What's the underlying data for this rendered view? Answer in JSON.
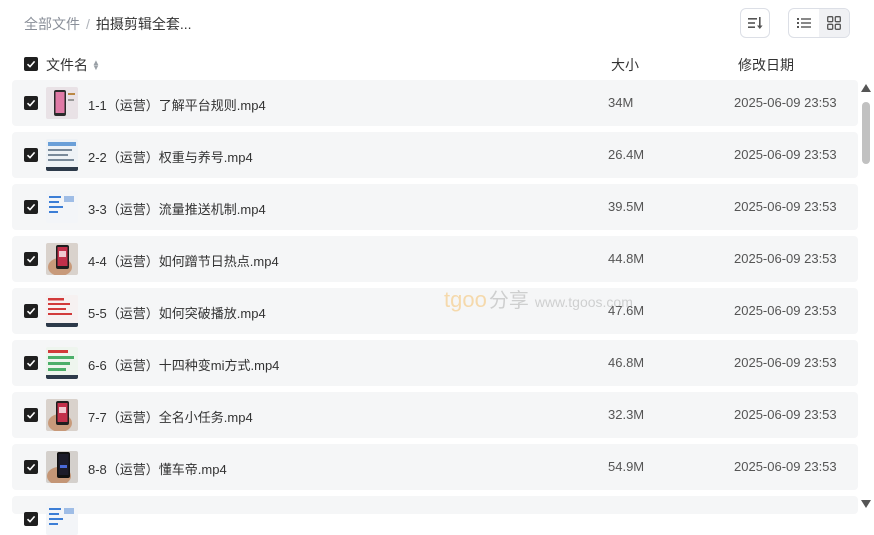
{
  "breadcrumb": {
    "root": "全部文件",
    "separator": "/",
    "current": "拍摄剪辑全套..."
  },
  "toolbar": {
    "sort_icon": "sort-descending-icon",
    "list_view_icon": "list-view-icon",
    "grid_view_icon": "grid-view-icon",
    "active_view": "list"
  },
  "table": {
    "headers": {
      "name": "文件名",
      "size": "大小",
      "date": "修改日期"
    },
    "all_checked": true,
    "rows": [
      {
        "name": "1-1（运营）了解平台规则.mp4",
        "size": "34M",
        "date": "2025-06-09 23:53",
        "checked": true,
        "thumb": "phone-pink"
      },
      {
        "name": "2-2（运营）权重与养号.mp4",
        "size": "26.4M",
        "date": "2025-06-09 23:53",
        "checked": true,
        "thumb": "doc-blue"
      },
      {
        "name": "3-3（运营）流量推送机制.mp4",
        "size": "39.5M",
        "date": "2025-06-09 23:53",
        "checked": true,
        "thumb": "doc-list"
      },
      {
        "name": "4-4（运营）如何蹭节日热点.mp4",
        "size": "44.8M",
        "date": "2025-06-09 23:53",
        "checked": true,
        "thumb": "hand-phone"
      },
      {
        "name": "5-5（运营）如何突破播放.mp4",
        "size": "47.6M",
        "date": "2025-06-09 23:53",
        "checked": true,
        "thumb": "doc-red"
      },
      {
        "name": "6-6（运营）十四种变mi方式.mp4",
        "size": "46.8M",
        "date": "2025-06-09 23:53",
        "checked": true,
        "thumb": "doc-green"
      },
      {
        "name": "7-7（运营）全名小任务.mp4",
        "size": "32.3M",
        "date": "2025-06-09 23:53",
        "checked": true,
        "thumb": "hand-phone"
      },
      {
        "name": "8-8（运营）懂车帝.mp4",
        "size": "54.9M",
        "date": "2025-06-09 23:53",
        "checked": true,
        "thumb": "hand-phone-dark"
      },
      {
        "name": "",
        "size": "",
        "date": "",
        "checked": true,
        "thumb": "doc-list"
      }
    ]
  },
  "watermark": {
    "logo": "tgoo",
    "cn": "分享",
    "url": "www.tgoos.com"
  },
  "colors": {
    "row_bg": "#f5f6f7",
    "checkbox": "#1f1f1f",
    "muted": "#8a8f99"
  }
}
